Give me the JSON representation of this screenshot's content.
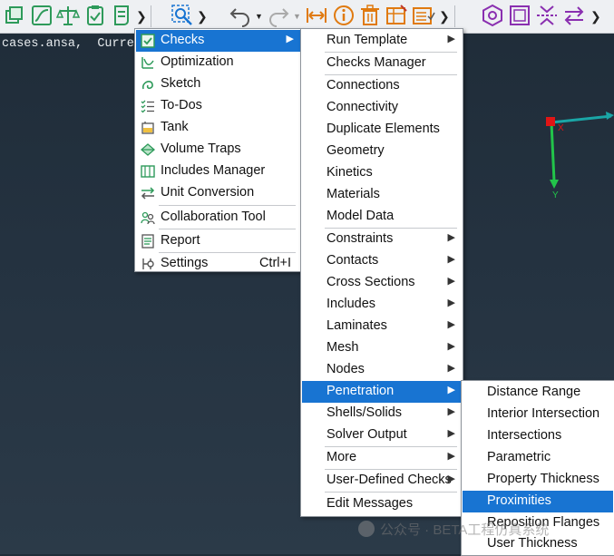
{
  "console": {
    "text": "cases.ansa,  Curre"
  },
  "axis": {
    "x_label": "X",
    "y_label": "Y"
  },
  "toolbar": {
    "icons": [
      "cube-stack-icon",
      "curve-icon",
      "balance-icon",
      "clipboard-check-icon",
      "scroll-icon",
      "search-zoom-icon",
      "undo-icon",
      "redo-icon",
      "measure-icon",
      "info-icon",
      "delete-icon",
      "table-icon",
      "edit-list-icon",
      "hexagon-icon",
      "frame-icon",
      "split-icon",
      "swap-icon"
    ]
  },
  "menu_tools": {
    "items": [
      {
        "label": "Checks",
        "selected": true,
        "submenu": true,
        "icon": "checks-icon"
      },
      {
        "label": "Optimization",
        "icon": "optimization-icon"
      },
      {
        "label": "Sketch",
        "icon": "sketch-icon"
      },
      {
        "label": "To-Dos",
        "icon": "todo-icon"
      },
      {
        "label": "Tank",
        "icon": "tank-icon"
      },
      {
        "label": "Volume Traps",
        "icon": "volume-traps-icon"
      },
      {
        "label": "Includes Manager",
        "icon": "includes-manager-icon"
      },
      {
        "label": "Unit Conversion",
        "icon": "unit-conversion-icon"
      },
      {
        "label": "Collaboration Tool",
        "icon": "collaboration-icon"
      },
      {
        "label": "Report",
        "icon": "report-icon"
      },
      {
        "label": "Settings",
        "shortcut": "Ctrl+I",
        "icon": "settings-icon"
      }
    ]
  },
  "menu_checks": {
    "items": [
      {
        "label": "Run Template",
        "submenu": true
      },
      {
        "label": "Checks Manager"
      },
      {
        "label": "Connections"
      },
      {
        "label": "Connectivity"
      },
      {
        "label": "Duplicate Elements"
      },
      {
        "label": "Geometry"
      },
      {
        "label": "Kinetics"
      },
      {
        "label": "Materials"
      },
      {
        "label": "Model Data"
      },
      {
        "label": "Constraints",
        "submenu": true
      },
      {
        "label": "Contacts",
        "submenu": true
      },
      {
        "label": "Cross Sections",
        "submenu": true
      },
      {
        "label": "Includes",
        "submenu": true
      },
      {
        "label": "Laminates",
        "submenu": true
      },
      {
        "label": "Mesh",
        "submenu": true
      },
      {
        "label": "Nodes",
        "submenu": true
      },
      {
        "label": "Penetration",
        "submenu": true,
        "selected": true
      },
      {
        "label": "Shells/Solids",
        "submenu": true
      },
      {
        "label": "Solver Output",
        "submenu": true
      },
      {
        "label": "More",
        "submenu": true
      },
      {
        "label": "User-Defined Checks",
        "submenu": true
      },
      {
        "label": "Edit Messages"
      }
    ]
  },
  "menu_penetration": {
    "items": [
      {
        "label": "Distance Range"
      },
      {
        "label": "Interior Intersection"
      },
      {
        "label": "Intersections"
      },
      {
        "label": "Parametric"
      },
      {
        "label": "Property Thickness"
      },
      {
        "label": "Proximities",
        "selected": true
      },
      {
        "label": "Reposition Flanges"
      },
      {
        "label": "User Thickness"
      }
    ]
  },
  "watermark": {
    "text": "公众号 · BETA工程仿真系统"
  },
  "colors": {
    "selection": "#1874d2",
    "toolbar_icon": "#2e9a5a",
    "icon_purple": "#8a2fb0",
    "axis_x": "#1aa6a6",
    "axis_y": "#22c44a",
    "origin": "#e01515"
  }
}
